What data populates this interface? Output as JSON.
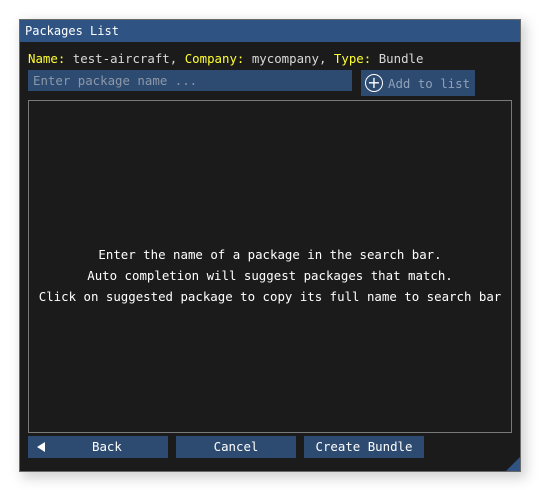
{
  "window": {
    "title": "Packages List"
  },
  "info": {
    "name_label": "Name:",
    "name_value": "test-aircraft,",
    "company_label": "Company:",
    "company_value": "mycompany,",
    "type_label": "Type:",
    "type_value": "Bundle"
  },
  "search": {
    "placeholder": "Enter package name ...",
    "value": ""
  },
  "add_button": {
    "label": "Add to list",
    "icon": "plus-circle-icon"
  },
  "list": {
    "hints": [
      "Enter the name of a package in the search bar.",
      "Auto completion will suggest packages that match.",
      "Click on suggested package to copy its full name to search bar"
    ]
  },
  "footer": {
    "back_label": "Back",
    "back_icon": "triangle-left-icon",
    "cancel_label": "Cancel",
    "create_label": "Create Bundle"
  },
  "colors": {
    "titlebar": "#2f5484",
    "button": "#2d4a70",
    "key_text": "#ffff33",
    "background": "#1b1b1b"
  }
}
